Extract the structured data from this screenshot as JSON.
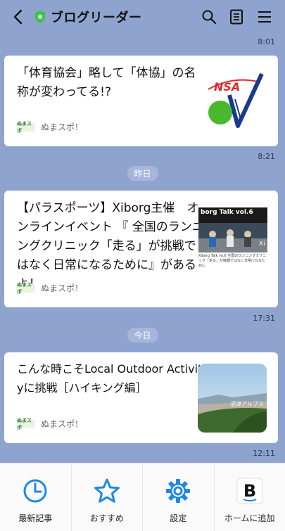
{
  "header": {
    "title": "ブログリーダー",
    "icons": [
      "back-icon",
      "shield-icon",
      "search-icon",
      "list-icon",
      "menu-icon"
    ]
  },
  "feed": {
    "time_1": "8:01",
    "time_2": "8:21",
    "date_1": "昨日",
    "time_3": "17:31",
    "date_2": "今日",
    "time_4": "12:11",
    "cards": [
      {
        "title_line1": "「体育協会」略して「体協」の名",
        "title_line2": "称が変わってる!?",
        "source_logo": "ぬまスポ",
        "source": "ぬまスポ！"
      },
      {
        "title_line1": "【パラスポーツ】Xiborg主催　オ",
        "title_line2": "ンラインイベント 『 全国のランニ",
        "title_line3": "ングクリニック「走る」が挑戦で",
        "title_line4": "はなく日常になるために』がある",
        "title_line5": "よ！",
        "thumb_text_top": "borg Talk vol.6",
        "thumb_text_bottom": "Xiborg Talk vo.6 全国のランニングクリニック「走る」が挑戦ではなく日常になるために",
        "source_logo": "ぬまスポ",
        "source": "ぬまスポ！"
      },
      {
        "title_line1": "こんな時こそLocal Outdoor Activit",
        "title_line2": "yに挑戦［ハイキング編］",
        "thumb_text": "沼津アルプス",
        "source_logo": "ぬまスポ",
        "source": "ぬまスポ！"
      }
    ]
  },
  "bottom_nav": [
    {
      "label": "最新記事",
      "icon": "clock-icon"
    },
    {
      "label": "おすすめ",
      "icon": "star-icon"
    },
    {
      "label": "設定",
      "icon": "gear-icon"
    },
    {
      "label": "ホームに追加",
      "icon": "blog-b-icon"
    }
  ],
  "colors": {
    "background": "#8fa3cf",
    "accent_blue": "#1e88e5",
    "shield_green": "#3ac34a"
  }
}
